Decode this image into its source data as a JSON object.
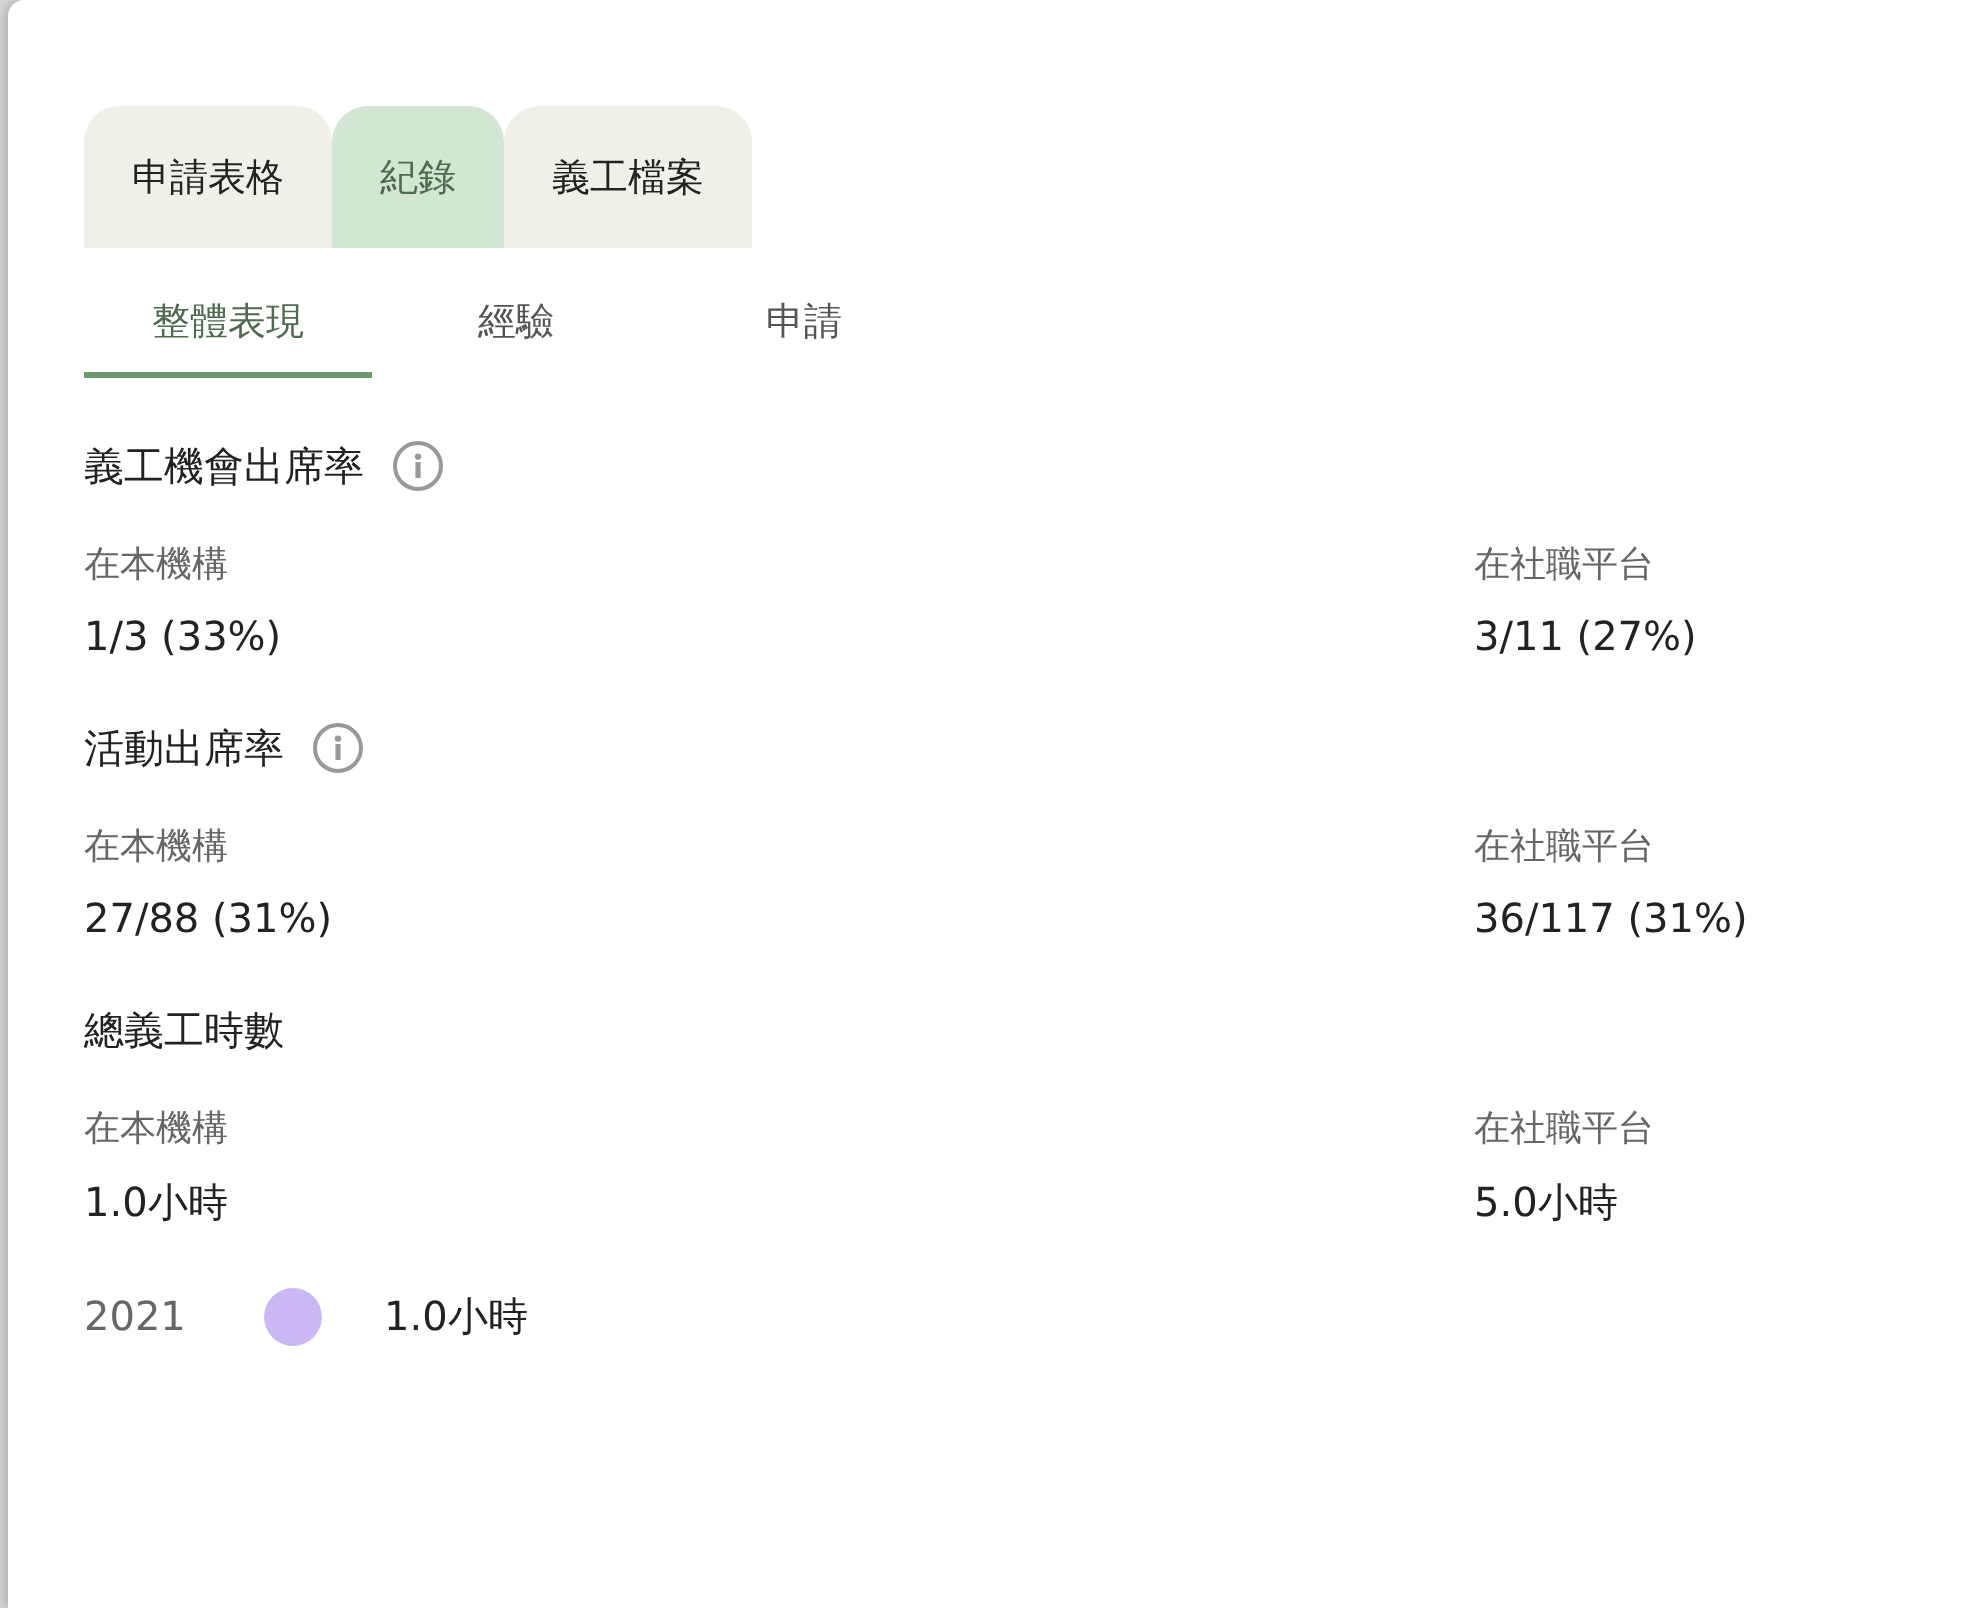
{
  "tabs": [
    {
      "label": "申請表格",
      "selected": false
    },
    {
      "label": "紀錄",
      "selected": true
    },
    {
      "label": "義工檔案",
      "selected": false
    }
  ],
  "subtabs": [
    {
      "label": "整體表現",
      "selected": true
    },
    {
      "label": "經驗",
      "selected": false
    },
    {
      "label": "申請",
      "selected": false
    }
  ],
  "sections": [
    {
      "title": "義工機會出席率",
      "info": true,
      "left_label": "在本機構",
      "left_value": "1/3 (33%)",
      "right_label": "在社職平台",
      "right_value": "3/11 (27%)"
    },
    {
      "title": "活動出席率",
      "info": true,
      "left_label": "在本機構",
      "left_value": "27/88 (31%)",
      "right_label": "在社職平台",
      "right_value": "36/117 (31%)"
    },
    {
      "title": "總義工時數",
      "info": false,
      "left_label": "在本機構",
      "left_value": "1.0小時",
      "right_label": "在社職平台",
      "right_value": "5.0小時"
    }
  ],
  "years": [
    {
      "year": "2021",
      "color": "#c9b8f3",
      "hours": "1.0小時"
    }
  ]
}
